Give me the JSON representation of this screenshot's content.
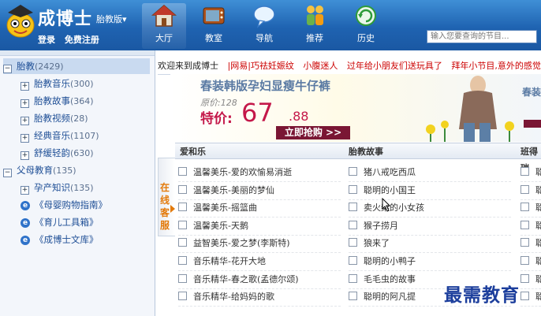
{
  "header": {
    "brand": "成博士",
    "brand_sub": "胎教版▾",
    "login": "登录",
    "register": "免费注册",
    "nav": [
      {
        "label": "大厅",
        "icon": "house-icon",
        "active": true
      },
      {
        "label": "教室",
        "icon": "tv-icon",
        "active": false
      },
      {
        "label": "导航",
        "icon": "chat-bubble-icon",
        "active": false
      },
      {
        "label": "推荐",
        "icon": "people-icon",
        "active": false
      },
      {
        "label": "历史",
        "icon": "history-refresh-icon",
        "active": false
      }
    ],
    "search_placeholder": "输入您要查询的节目..."
  },
  "sidebar": {
    "root": {
      "label": "胎教",
      "count": "(2429)"
    },
    "children": [
      {
        "label": "胎教音乐",
        "count": "(300)"
      },
      {
        "label": "胎教故事",
        "count": "(364)"
      },
      {
        "label": "胎教视频",
        "count": "(28)"
      },
      {
        "label": "经典音乐",
        "count": "(1107)"
      },
      {
        "label": "舒缓轻韵",
        "count": "(630)"
      }
    ],
    "root2": {
      "label": "父母教育",
      "count": "(135)"
    },
    "children2": [
      {
        "label": "孕产知识",
        "count": "(135)"
      },
      {
        "label": "《母婴购物指南》",
        "count": ""
      },
      {
        "label": "《育儿工具箱》",
        "count": ""
      },
      {
        "label": "《成博士文库》",
        "count": ""
      }
    ]
  },
  "ticker": [
    "欢迎来到成博士",
    "|网易|巧祛妊娠纹",
    "小腹迷人",
    "过年给小朋友们送玩具了",
    "拜年小节目,意外的感觉"
  ],
  "ad": {
    "title": "春装韩版孕妇显瘦牛仔裤",
    "orig": "原价:128",
    "price_label": "特价:",
    "price": "67",
    "price_small": ".88",
    "buy": "立即抢购 >>",
    "right_title": "春装"
  },
  "online_service": "在线客服",
  "columns": [
    {
      "title": "爱和乐",
      "items": [
        "温馨美乐-爱的欢愉易消逝",
        "温馨美乐-美丽的梦仙",
        "温馨美乐-摇篮曲",
        "温馨美乐-天鹅",
        "益智美乐-爱之梦(李斯特)",
        "音乐精华-花开大地",
        "音乐精华-春之歌(孟德尔颂)",
        "音乐精华-给妈妈的歌"
      ]
    },
    {
      "title": "胎教故事",
      "items": [
        "猪八戒吃西瓜",
        "聪明的小国王",
        "卖火柴的小女孩",
        "猴子捞月",
        "狼来了",
        "聪明的小鸭子",
        "毛毛虫的故事",
        "聪明的阿凡提"
      ]
    },
    {
      "title": "班得瑞",
      "items": [
        "聪",
        "聪",
        "聪",
        "聪",
        "聪",
        "聪",
        "聪",
        "聪"
      ]
    }
  ],
  "watermark": "最需教育"
}
